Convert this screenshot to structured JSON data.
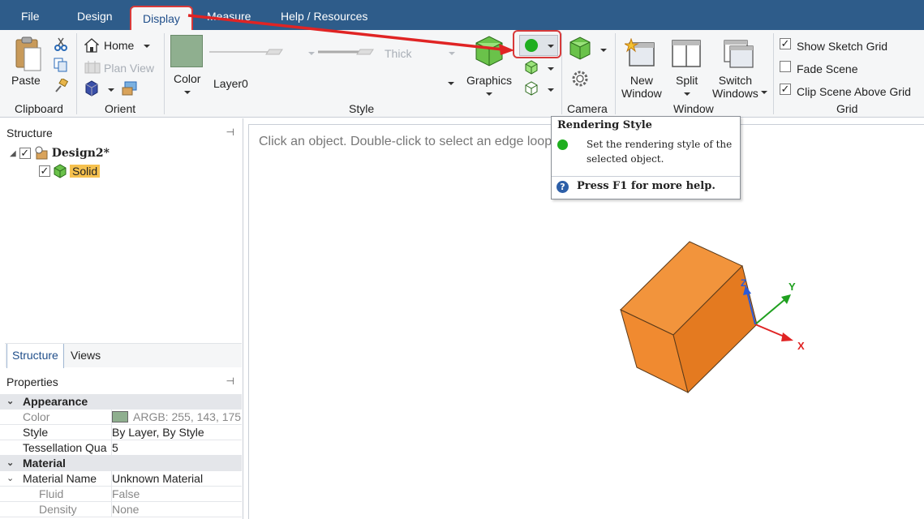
{
  "tabs": [
    "File",
    "Design",
    "Display",
    "Measure",
    "Help / Resources"
  ],
  "active_tab": "Display",
  "clipboard": {
    "paste": "Paste",
    "group": "Clipboard"
  },
  "orient": {
    "home": "Home",
    "plan_view": "Plan View",
    "group": "Orient"
  },
  "style": {
    "color": "Color",
    "layer": "Layer0",
    "thick": "Thick",
    "graphics": "Graphics",
    "group": "Style"
  },
  "camera": {
    "group": "Camera"
  },
  "window": {
    "new_window": [
      "New",
      "Window"
    ],
    "split": "Split",
    "switch_windows": [
      "Switch",
      "Windows"
    ],
    "group": "Window"
  },
  "grid": {
    "show_sketch_grid": "Show Sketch Grid",
    "fade_scene": "Fade Scene",
    "clip_scene": "Clip Scene Above Grid",
    "group": "Grid",
    "show_sketch_grid_checked": true,
    "fade_scene_checked": false,
    "clip_scene_checked": true
  },
  "structure": {
    "title": "Structure",
    "design": "Design2*",
    "solid": "Solid"
  },
  "panel_tabs": [
    "Structure",
    "Views"
  ],
  "properties": {
    "title": "Properties",
    "sections": [
      {
        "name": "Appearance",
        "rows": [
          {
            "name": "Color",
            "value": "ARGB: 255, 143, 175",
            "dim_name": true,
            "swatch": true
          },
          {
            "name": "Style",
            "value": "By Layer, By Style"
          },
          {
            "name": "Tessellation Qua",
            "value": "5"
          }
        ]
      },
      {
        "name": "Material",
        "rows": [
          {
            "name": "Material Name",
            "value": "Unknown Material"
          },
          {
            "name": "Fluid",
            "value": "False",
            "sub": true
          },
          {
            "name": "Density",
            "value": "None",
            "sub": true
          }
        ]
      }
    ]
  },
  "canvas": {
    "hint": "Click an object. Double-click to select an edge loop."
  },
  "tooltip": {
    "title": "Rendering Style",
    "description": "Set the rendering style of the selected object.",
    "help": "Press F1 for more help."
  },
  "axes": {
    "x": "X",
    "y": "Y",
    "z": "Z"
  },
  "colors": {
    "tabbar": "#2e5c8a",
    "highlight": "#d83a3a",
    "solid": "#f08a30",
    "layer_color": "#8faf8f"
  }
}
